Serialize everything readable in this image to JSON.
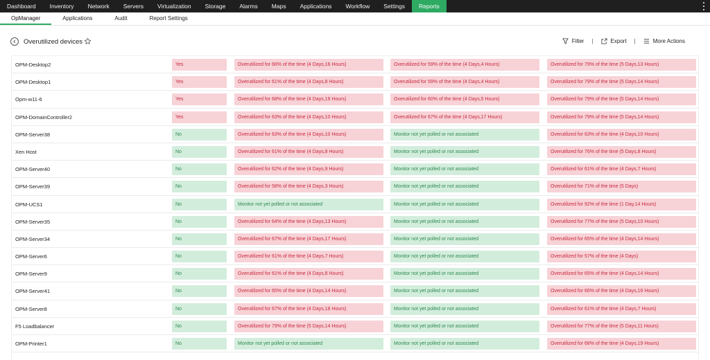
{
  "topnav": {
    "items": [
      "Dashboard",
      "Inventory",
      "Network",
      "Servers",
      "Virtualization",
      "Storage",
      "Alarms",
      "Maps",
      "Applications",
      "Workflow",
      "Settings",
      "Reports"
    ],
    "active": "Reports"
  },
  "subnav": {
    "items": [
      "OpManager",
      "Applications",
      "Audit",
      "Report Settings"
    ],
    "active": "OpManager"
  },
  "header": {
    "title": "Overutilized devices",
    "filter_label": "Filter",
    "export_label": "Export",
    "more_label": "More Actions",
    "separator": "|"
  },
  "colors": {
    "accent": "#2eaa62",
    "red_bg": "#f7d2d7",
    "red_text": "#c8273b",
    "green_bg": "#d3eddd",
    "green_text": "#2d8a4e",
    "nav_bg": "#1f1f1f"
  },
  "rows": [
    {
      "name": "OPM-Desktop2",
      "flag": "Yes",
      "c2": "Overutilized for 66% of the time (4 Days,16 Hours)",
      "c3": "Overutilized for 59% of the time (4 Days,4 Hours)",
      "c4": "Overutilized for 79% of the time (5 Days,13 Hours)"
    },
    {
      "name": "OPM-Desktop1",
      "flag": "Yes",
      "c2": "Overutilized for 61% of the time (4 Days,8 Hours)",
      "c3": "Overutilized for 59% of the time (4 Days,4 Hours)",
      "c4": "Overutilized for 79% of the time (5 Days,14 Hours)"
    },
    {
      "name": "Opm-w11-6",
      "flag": "Yes",
      "c2": "Overutilized for 68% of the time (4 Days,19 Hours)",
      "c3": "Overutilized for 60% of the time (4 Days,5 Hours)",
      "c4": "Overutilized for 79% of the time (5 Days,14 Hours)"
    },
    {
      "name": "OPM-DomainController2",
      "flag": "Yes",
      "c2": "Overutilized for 63% of the time (4 Days,10 Hours)",
      "c3": "Overutilized for 67% of the time (4 Days,17 Hours)",
      "c4": "Overutilized for 79% of the time (5 Days,14 Hours)"
    },
    {
      "name": "OPM-Server38",
      "flag": "No",
      "c2": "Overutilized for 63% of the time (4 Days,10 Hours)",
      "c3": "Monitor not yet polled or not associated",
      "c4": "Overutilized for 63% of the time (4 Days,10 Hours)"
    },
    {
      "name": "Xen Host",
      "flag": "No",
      "c2": "Overutilized for 61% of the time (4 Days,8 Hours)",
      "c3": "Monitor not yet polled or not associated",
      "c4": "Overutilized for 76% of the time (5 Days,8 Hours)"
    },
    {
      "name": "OPM-Server40",
      "flag": "No",
      "c2": "Overutilized for 62% of the time (4 Days,9 Hours)",
      "c3": "Monitor not yet polled or not associated",
      "c4": "Overutilized for 61% of the time (4 Days,7 Hours)"
    },
    {
      "name": "OPM-Server39",
      "flag": "No",
      "c2": "Overutilized for 58% of the time (4 Days,3 Hours)",
      "c3": "Monitor not yet polled or not associated",
      "c4": "Overutilized for 71% of the time (5 Days)"
    },
    {
      "name": "OPM-UCS1",
      "flag": "No",
      "c2": "Monitor not yet polled or not associated",
      "c3": "Monitor not yet polled or not associated",
      "c4": "Overutilized for 92% of the time (1 Day,14 Hours)"
    },
    {
      "name": "OPM-Server35",
      "flag": "No",
      "c2": "Overutilized for 64% of the time (4 Days,13 Hours)",
      "c3": "Monitor not yet polled or not associated",
      "c4": "Overutilized for 77% of the time (5 Days,10 Hours)"
    },
    {
      "name": "OPM-Server34",
      "flag": "No",
      "c2": "Overutilized for 67% of the time (4 Days,17 Hours)",
      "c3": "Monitor not yet polled or not associated",
      "c4": "Overutilized for 65% of the time (4 Days,14 Hours)"
    },
    {
      "name": "OPM-Server6",
      "flag": "No",
      "c2": "Overutilized for 61% of the time (4 Days,7 Hours)",
      "c3": "Monitor not yet polled or not associated",
      "c4": "Overutilized for 57% of the time (4 Days)"
    },
    {
      "name": "OPM-Server9",
      "flag": "No",
      "c2": "Overutilized for 61% of the time (4 Days,8 Hours)",
      "c3": "Monitor not yet polled or not associated",
      "c4": "Overutilized for 65% of the time (4 Days,14 Hours)"
    },
    {
      "name": "OPM-Server41",
      "flag": "No",
      "c2": "Overutilized for 65% of the time (4 Days,14 Hours)",
      "c3": "Monitor not yet polled or not associated",
      "c4": "Overutilized for 66% of the time (4 Days,16 Hours)"
    },
    {
      "name": "OPM-Server8",
      "flag": "No",
      "c2": "Overutilized for 67% of the time (4 Days,18 Hours)",
      "c3": "Monitor not yet polled or not associated",
      "c4": "Overutilized for 61% of the time (4 Days,7 Hours)"
    },
    {
      "name": "F5 Loadbalancer",
      "flag": "No",
      "c2": "Overutilized for 79% of the time (5 Days,14 Hours)",
      "c3": "Monitor not yet polled or not associated",
      "c4": "Overutilized for 77% of the time (5 Days,11 Hours)"
    },
    {
      "name": "OPM-Printer1",
      "flag": "No",
      "c2": "Monitor not yet polled or not associated",
      "c3": "Monitor not yet polled or not associated",
      "c4": "Overutilized for 68% of the time (4 Days,19 Hours)"
    }
  ]
}
